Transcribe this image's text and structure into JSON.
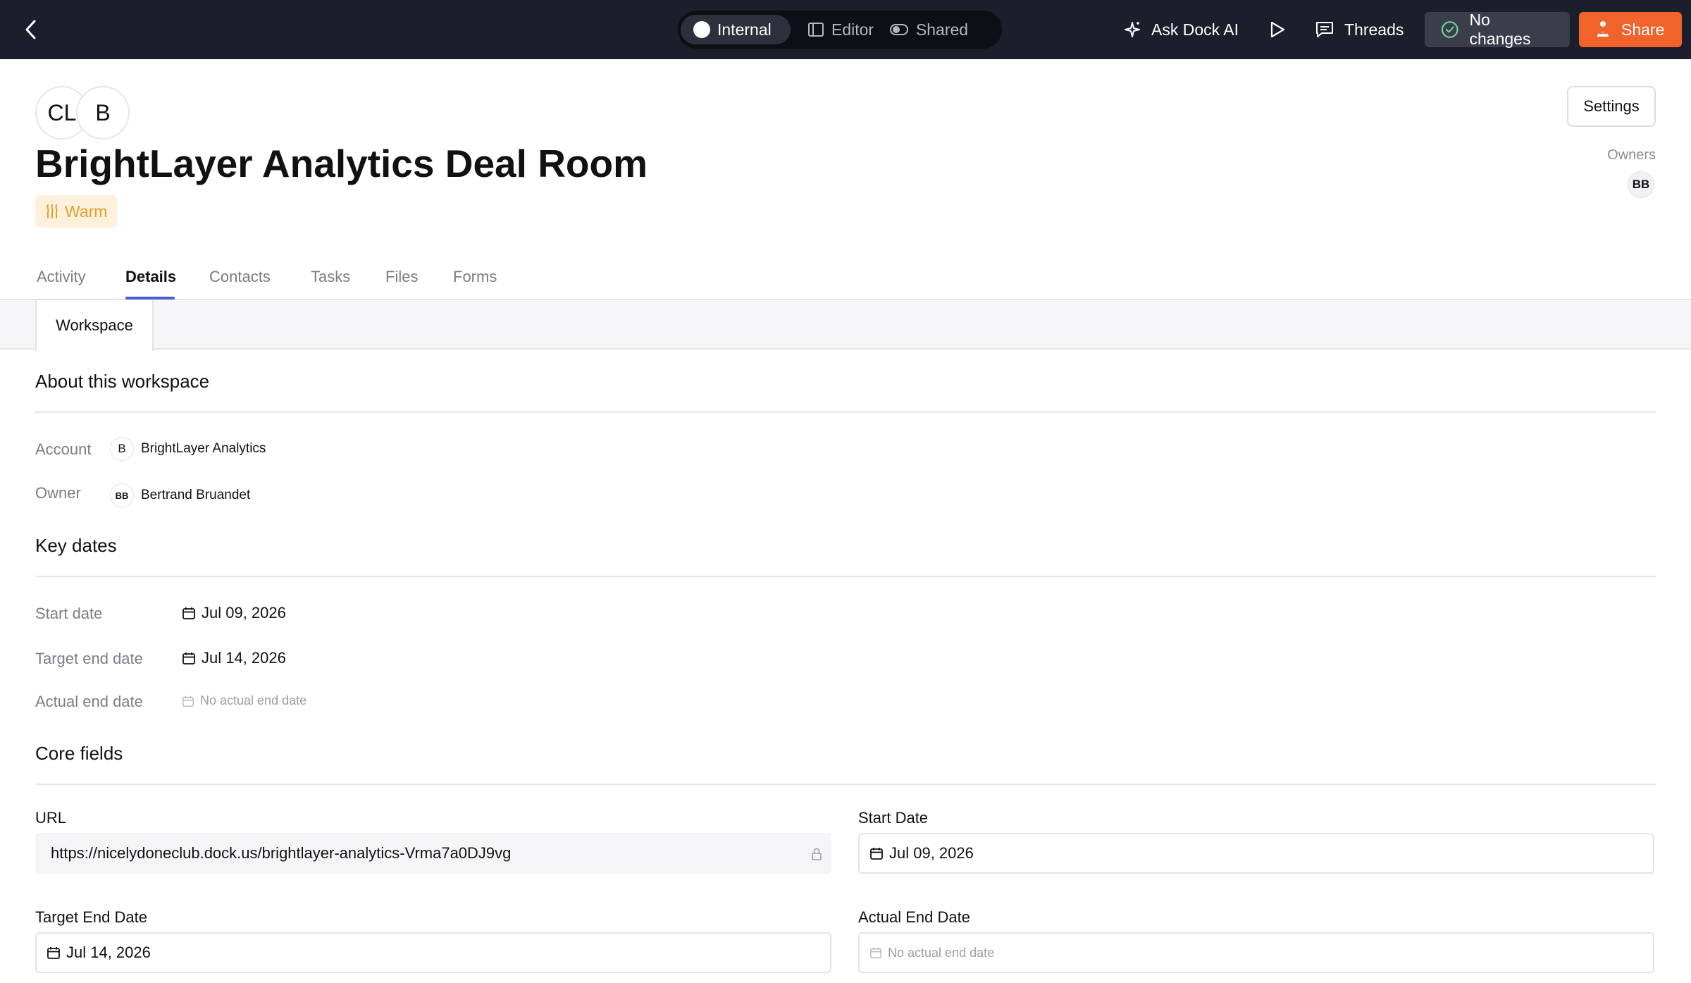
{
  "topbar": {
    "modes": [
      {
        "label": "Internal",
        "active": true,
        "icon": "circle-icon"
      },
      {
        "label": "Editor",
        "active": false,
        "icon": "panel-icon"
      },
      {
        "label": "Shared",
        "active": false,
        "icon": "toggle-icon"
      }
    ],
    "ask_ai_label": "Ask Dock AI",
    "threads_label": "Threads",
    "status_label": "No changes",
    "share_label": "Share",
    "colors": {
      "bar": "#1b1e2b",
      "share": "#f2622b",
      "status_bg": "#3a3d4a"
    }
  },
  "header": {
    "avatars": [
      "CL",
      "B"
    ],
    "title": "BrightLayer Analytics Deal Room",
    "badge": "Warm",
    "badge_color": "#e0a030",
    "settings_label": "Settings",
    "owners_label": "Owners",
    "owner_initials": "BB"
  },
  "tabs": [
    {
      "label": "Activity",
      "active": false
    },
    {
      "label": "Details",
      "active": true
    },
    {
      "label": "Contacts",
      "active": false
    },
    {
      "label": "Tasks",
      "active": false
    },
    {
      "label": "Files",
      "active": false
    },
    {
      "label": "Forms",
      "active": false
    }
  ],
  "subtab": {
    "label": "Workspace"
  },
  "about": {
    "title": "About this workspace",
    "account_label": "Account",
    "account_avatar": "B",
    "account_value": "BrightLayer Analytics",
    "owner_label": "Owner",
    "owner_avatar": "BB",
    "owner_value": "Bertrand Bruandet"
  },
  "key_dates": {
    "title": "Key dates",
    "start_label": "Start date",
    "start_value": "Jul 09, 2026",
    "target_label": "Target end date",
    "target_value": "Jul 14, 2026",
    "actual_label": "Actual end date",
    "actual_value": "No actual end date"
  },
  "core_fields": {
    "title": "Core fields",
    "url_label": "URL",
    "url_value": "https://nicelydoneclub.dock.us/brightlayer-analytics-Vrma7a0DJ9vg",
    "start_label": "Start Date",
    "start_value": "Jul 09, 2026",
    "target_label": "Target End Date",
    "target_value": "Jul 14, 2026",
    "actual_label": "Actual End Date",
    "actual_placeholder": "No actual end date"
  }
}
